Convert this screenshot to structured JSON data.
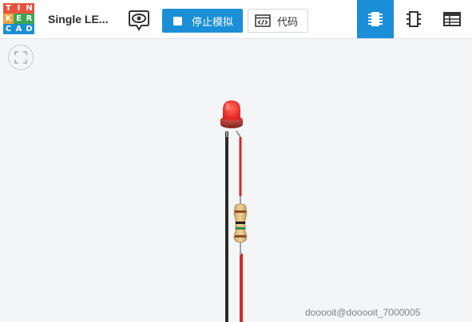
{
  "logo": {
    "letters": [
      "T",
      "I",
      "N",
      "K",
      "E",
      "R",
      "C",
      "A",
      "D"
    ],
    "colors": [
      "#e8523d",
      "#e8523d",
      "#e8523d",
      "#f0a23a",
      "#3aa655",
      "#3aa655",
      "#1a8fd8",
      "#1a8fd8",
      "#1a8fd8"
    ]
  },
  "header": {
    "title": "Single LE...",
    "stop_label": "停止模拟",
    "code_label": "代码"
  },
  "icons": {
    "logo": "tinkercad-logo",
    "eye": "eye-icon",
    "stop": "stop-icon",
    "code": "code-icon",
    "components": "components-icon",
    "schematic": "schematic-icon",
    "component_list": "list-icon",
    "fullscreen": "fullscreen-icon"
  },
  "colors": {
    "accent": "#1a8fd8",
    "led": "#e8322f",
    "wire_red": "#d4282a",
    "wire_black": "#2a2a2a"
  },
  "watermark": "dooooit@dooooit_7000005"
}
